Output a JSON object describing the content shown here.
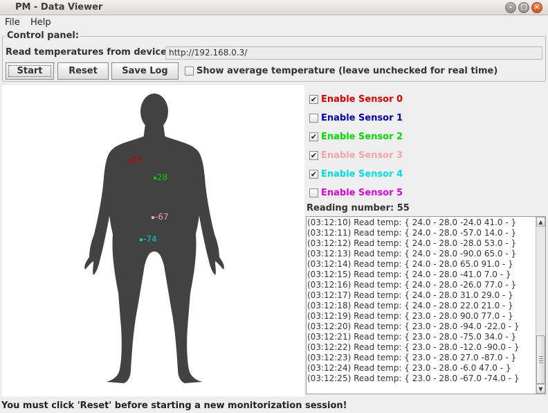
{
  "window": {
    "title": "PM - Data Viewer"
  },
  "menu": {
    "file": "File",
    "help": "Help"
  },
  "control_panel": {
    "title": "Control panel:",
    "read_label": "Read temperatures from device:",
    "url_value": "http://192.168.0.3/",
    "start_label": "Start",
    "reset_label": "Reset",
    "savelog_label": "Save Log",
    "avg_checkbox_label": "Show average temperature (leave unchecked for real time)",
    "avg_checked": false
  },
  "body_markers": [
    {
      "label": "23",
      "color": "#cc0000"
    },
    {
      "label": "28",
      "color": "#00cc00"
    },
    {
      "label": "-67",
      "color": "#f4a0a0"
    },
    {
      "label": "-74",
      "color": "#00cccc"
    }
  ],
  "sensors": [
    {
      "label": "Enable Sensor 0",
      "checked": true,
      "color": "#dd0000"
    },
    {
      "label": "Enable Sensor 1",
      "checked": false,
      "color": "#0000bb"
    },
    {
      "label": "Enable Sensor 2",
      "checked": true,
      "color": "#00dd00"
    },
    {
      "label": "Enable Sensor 3",
      "checked": true,
      "color": "#f4a6a6"
    },
    {
      "label": "Enable Sensor 4",
      "checked": true,
      "color": "#00e0e0"
    },
    {
      "label": "Enable Sensor 5",
      "checked": false,
      "color": "#dd00dd"
    }
  ],
  "reading_number": "Reading number: 55",
  "log_lines": [
    "(03:12:10) Read temp: { 24.0 - 28.0 -24.0 41.0 -  }",
    "(03:12:11) Read temp: { 24.0 - 28.0 -57.0 14.0 -  }",
    "(03:12:12) Read temp: { 24.0 - 28.0 -28.0 53.0 -  }",
    "(03:12:13) Read temp: { 24.0 - 28.0 -90.0 65.0 -  }",
    "(03:12:14) Read temp: { 24.0 - 28.0 65.0 91.0 -  }",
    "(03:12:15) Read temp: { 24.0 - 28.0 -41.0 7.0 -  }",
    "(03:12:16) Read temp: { 24.0 - 28.0 -26.0 77.0 -  }",
    "(03:12:17) Read temp: { 24.0 - 28.0 31.0 29.0 -  }",
    "(03:12:18) Read temp: { 24.0 - 28.0 22.0 21.0 -  }",
    "(03:12:19) Read temp: { 23.0 - 28.0 90.0 77.0 -  }",
    "(03:12:20) Read temp: { 23.0 - 28.0 -94.0 -22.0 -  }",
    "(03:12:21) Read temp: { 23.0 - 28.0 -75.0 34.0 -  }",
    "(03:12:22) Read temp: { 23.0 - 28.0 -12.0 -90.0 -  }",
    "(03:12:23) Read temp: { 23.0 - 28.0 27.0 -87.0 -  }",
    "(03:12:24) Read temp: { 23.0 - 28.0 -6.0 47.0 -  }",
    "(03:12:25) Read temp: { 23.0 - 28.0 -67.0 -74.0 -  }"
  ],
  "status_text": "You must click 'Reset' before starting a new monitorization session!"
}
